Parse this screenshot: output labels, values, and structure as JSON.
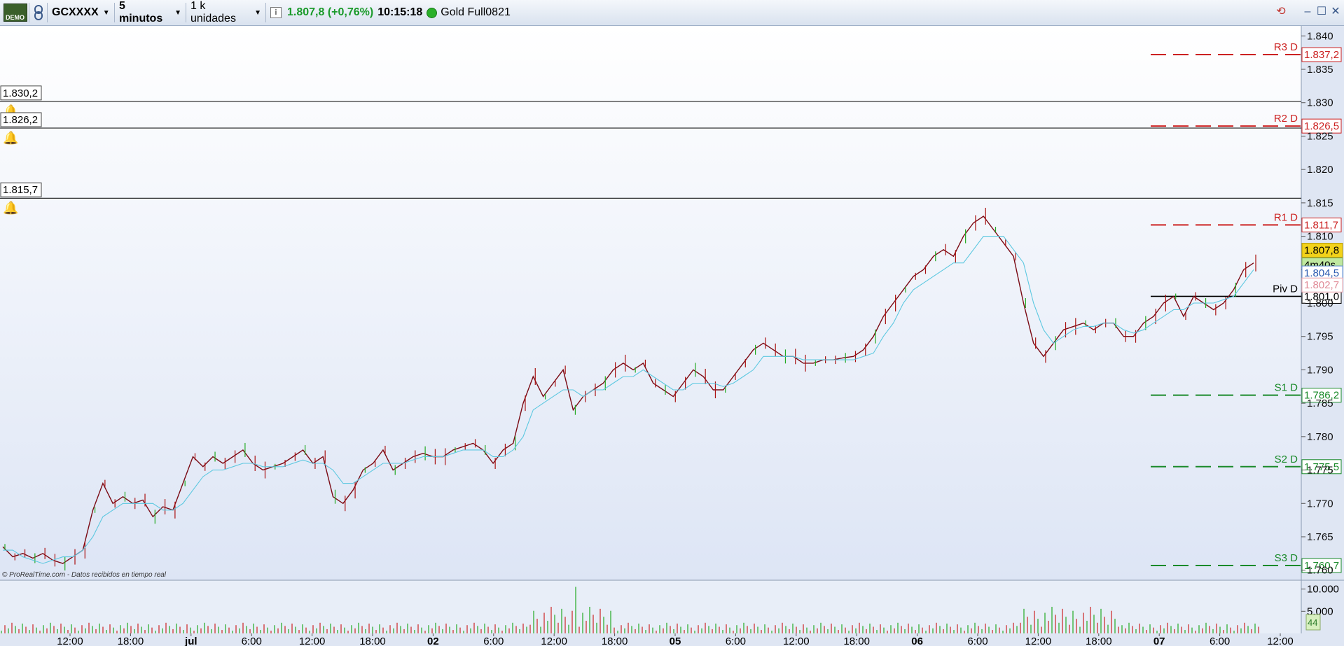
{
  "toolbar": {
    "demo_label": "DEMO",
    "chain_icon": "link-icon",
    "instrument": "GCXXXX",
    "timeframe": "5 minutos",
    "units": "1 k unidades",
    "info_icon": "info-icon",
    "price": "1.807,8 (+0,76%)",
    "time": "10:15:18",
    "status_color": "#2ab02a",
    "contract": "Gold Full0821",
    "window_icons": [
      "refresh-icon",
      "minimize-icon",
      "maximize-icon",
      "close-icon"
    ]
  },
  "alerts": [
    {
      "label": "1.830,2"
    },
    {
      "label": "1.826,2"
    },
    {
      "label": "1.815,7"
    }
  ],
  "pivots": [
    {
      "name": "R3 D",
      "value": "1.837,2",
      "color": "#cc2222"
    },
    {
      "name": "R2 D",
      "value": "1.826,5",
      "color": "#cc2222"
    },
    {
      "name": "R1 D",
      "value": "1.811,7",
      "color": "#cc2222"
    },
    {
      "name": "Piv D",
      "value": "1.801,0",
      "color": "#000000"
    },
    {
      "name": "S1 D",
      "value": "1.786,2",
      "color": "#1a8a2a"
    },
    {
      "name": "S2 D",
      "value": "1.775,5",
      "color": "#1a8a2a"
    },
    {
      "name": "S3 D",
      "value": "1.760,7",
      "color": "#1a8a2a"
    }
  ],
  "tags": {
    "last_price": "1.807,8",
    "countdown": "4m40s",
    "blue": "1.804,5",
    "pink": "1.802,7"
  },
  "credit": "© ProRealTime.com - Datos recibidos en tiempo real",
  "volume_axis": [
    "10.000",
    "5.000"
  ],
  "volume_tag": "44",
  "chart_data": {
    "type": "line",
    "price_ticks": [
      "1.840",
      "1.835",
      "1.830",
      "1.825",
      "1.820",
      "1.815",
      "1.810",
      "1.805",
      "1.800",
      "1.795",
      "1.790",
      "1.785",
      "1.780",
      "1.775",
      "1.770",
      "1.765",
      "1.760"
    ],
    "ylim": [
      1758.5,
      1841.5
    ],
    "x_labels": [
      "12:00",
      "18:00",
      "jul",
      "6:00",
      "12:00",
      "18:00",
      "02",
      "6:00",
      "12:00",
      "18:00",
      "05",
      "6:00",
      "12:00",
      "18:00",
      "06",
      "6:00",
      "12:00",
      "18:00",
      "07",
      "6:00",
      "12:00"
    ],
    "bold_x_labels": [
      "jul",
      "02",
      "05",
      "06",
      "07"
    ],
    "series": [
      {
        "color": "#7a0a14",
        "values": [
          1763.5,
          1762,
          1762.5,
          1761.8,
          1762.5,
          1761.5,
          1761,
          1762,
          1763,
          1769,
          1773,
          1770,
          1771,
          1770,
          1770.5,
          1768,
          1769.5,
          1769,
          1773,
          1777,
          1775.5,
          1777,
          1776,
          1777,
          1778,
          1776,
          1775,
          1775.5,
          1776,
          1777,
          1778,
          1776,
          1777,
          1771,
          1770,
          1772,
          1775,
          1776,
          1778,
          1775,
          1776,
          1777,
          1777.5,
          1777,
          1777,
          1778,
          1778.5,
          1779,
          1778,
          1776,
          1778,
          1779,
          1785,
          1789,
          1786,
          1788,
          1790,
          1784,
          1786,
          1787,
          1788,
          1790,
          1791,
          1790,
          1791,
          1788,
          1787,
          1786,
          1788,
          1790,
          1789,
          1787,
          1787,
          1789,
          1791,
          1793,
          1794,
          1793,
          1792,
          1792,
          1791,
          1791,
          1791.5,
          1791.5,
          1791.8,
          1792,
          1793,
          1795,
          1798,
          1800,
          1802,
          1804,
          1805,
          1807,
          1808,
          1807,
          1810,
          1812,
          1813,
          1811,
          1809,
          1807,
          1800,
          1794,
          1792,
          1794,
          1796,
          1796.5,
          1797,
          1796,
          1797,
          1797,
          1795,
          1795,
          1797,
          1798,
          1800,
          1801,
          1798,
          1801,
          1800,
          1799,
          1800,
          1802,
          1805,
          1806
        ]
      },
      {
        "color": "#5cc8e0",
        "values": [
          1763,
          1763,
          1762,
          1761.5,
          1761,
          1761.5,
          1762,
          1762,
          1763,
          1765,
          1768,
          1769,
          1770,
          1770,
          1770,
          1770,
          1769,
          1769,
          1770,
          1772,
          1774,
          1775,
          1775,
          1775.5,
          1776,
          1776,
          1775.5,
          1775.5,
          1775.5,
          1776,
          1776.5,
          1776,
          1776,
          1775,
          1773,
          1773,
          1774,
          1775,
          1776,
          1776,
          1776,
          1776.5,
          1777,
          1777,
          1777,
          1777.5,
          1778,
          1778,
          1778,
          1777,
          1777,
          1778,
          1780,
          1784,
          1785,
          1786,
          1787,
          1787,
          1786,
          1787,
          1787,
          1788,
          1789,
          1789,
          1790,
          1789,
          1788,
          1787,
          1787,
          1788,
          1788,
          1788,
          1787.5,
          1788,
          1789,
          1790,
          1792,
          1792,
          1792,
          1792,
          1791.5,
          1791.5,
          1791.5,
          1791.5,
          1791.5,
          1791.5,
          1792,
          1792.5,
          1795,
          1797,
          1800,
          1802,
          1803,
          1804,
          1805,
          1806,
          1806,
          1808,
          1810,
          1810,
          1810,
          1808,
          1806,
          1800,
          1796,
          1794,
          1795,
          1796,
          1796.5,
          1796.5,
          1797,
          1797,
          1796,
          1795.5,
          1796,
          1797,
          1798,
          1799,
          1799,
          1800,
          1800,
          1800,
          1800.5,
          1801,
          1803,
          1805
        ]
      }
    ],
    "volume": {
      "ylim": [
        0,
        12000
      ],
      "ticks": [
        "10.000",
        "5.000"
      ]
    }
  }
}
